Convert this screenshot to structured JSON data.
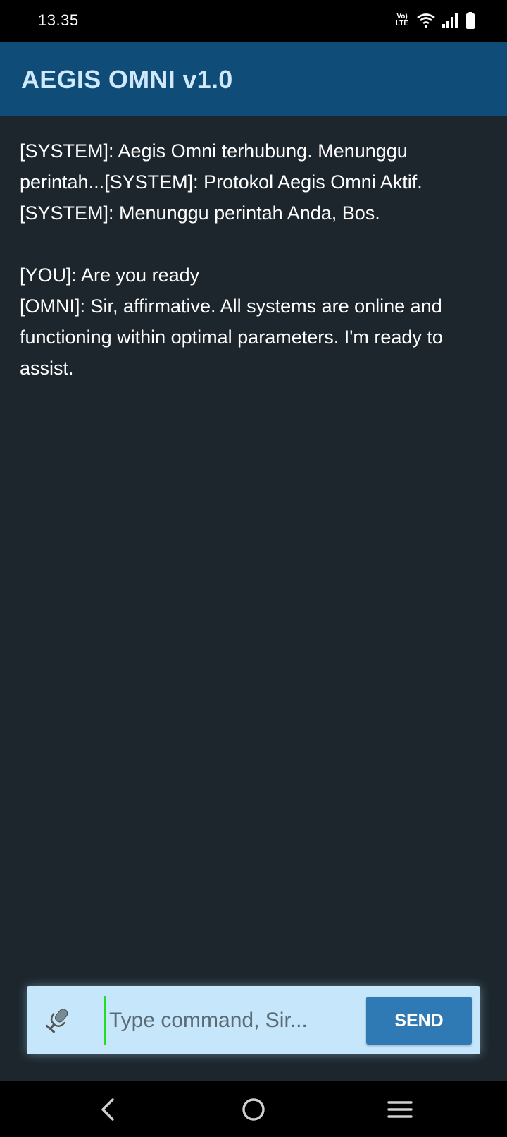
{
  "status_bar": {
    "time": "13.35",
    "volte_top": "Vo)",
    "volte_bottom": "LTE",
    "icons": [
      "volte-icon",
      "wifi-icon",
      "signal-icon",
      "battery-icon"
    ]
  },
  "app_bar": {
    "title": "AEGIS OMNI v1.0",
    "background_color": "#0f4c78"
  },
  "chat": {
    "lines": [
      "[SYSTEM]: Aegis Omni terhubung. Menunggu perintah...[SYSTEM]: Protokol Aegis Omni Aktif.",
      "[SYSTEM]: Menunggu perintah Anda, Bos.",
      "",
      "[YOU]: Are you ready",
      "[OMNI]: Sir, affirmative. All systems are online and functioning within optimal parameters. I'm ready to assist."
    ]
  },
  "input": {
    "mic_icon": "microphone-icon",
    "value": "",
    "placeholder": "Type command, Sir...",
    "send_label": "SEND",
    "send_color": "#2f7ab5"
  },
  "nav_bar": {
    "buttons": [
      "back-icon",
      "home-icon",
      "recents-menu-icon"
    ]
  }
}
